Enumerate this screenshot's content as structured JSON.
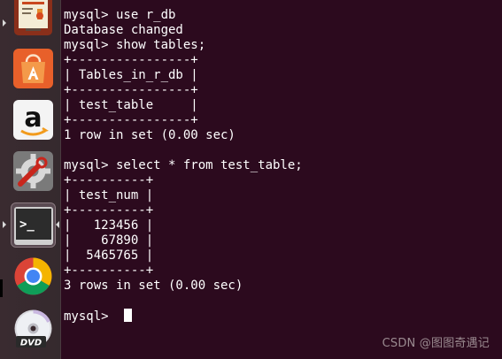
{
  "launcher": {
    "items": [
      {
        "name": "LibreOffice Impress",
        "icon": "presentation-icon"
      },
      {
        "name": "Ubuntu Software Center",
        "icon": "shopping-bag-icon"
      },
      {
        "name": "Amazon",
        "icon": "amazon-icon"
      },
      {
        "name": "System Settings",
        "icon": "settings-wrench-icon"
      },
      {
        "name": "Terminal",
        "icon": "terminal-icon",
        "active": true
      },
      {
        "name": "Chromium",
        "icon": "chrome-icon"
      },
      {
        "name": "DVD",
        "icon": "dvd-icon"
      }
    ],
    "amazon_letter": "a",
    "terminal_prompt": ">_",
    "dvd_label": "DVD"
  },
  "terminal": {
    "lines": [
      "mysql> use r_db",
      "Database changed",
      "mysql> show tables;",
      "+----------------+",
      "| Tables_in_r_db |",
      "+----------------+",
      "| test_table     |",
      "+----------------+",
      "1 row in set (0.00 sec)",
      "",
      "mysql> select * from test_table;",
      "+----------+",
      "| test_num |",
      "+----------+",
      "|   123456 |",
      "|    67890 |",
      "|  5465765 |",
      "+----------+",
      "3 rows in set (0.00 sec)",
      "",
      "mysql> "
    ],
    "colors": {
      "background": "#2c0a1e",
      "foreground": "#ffffff"
    }
  },
  "watermark": "CSDN @图图奇遇记"
}
